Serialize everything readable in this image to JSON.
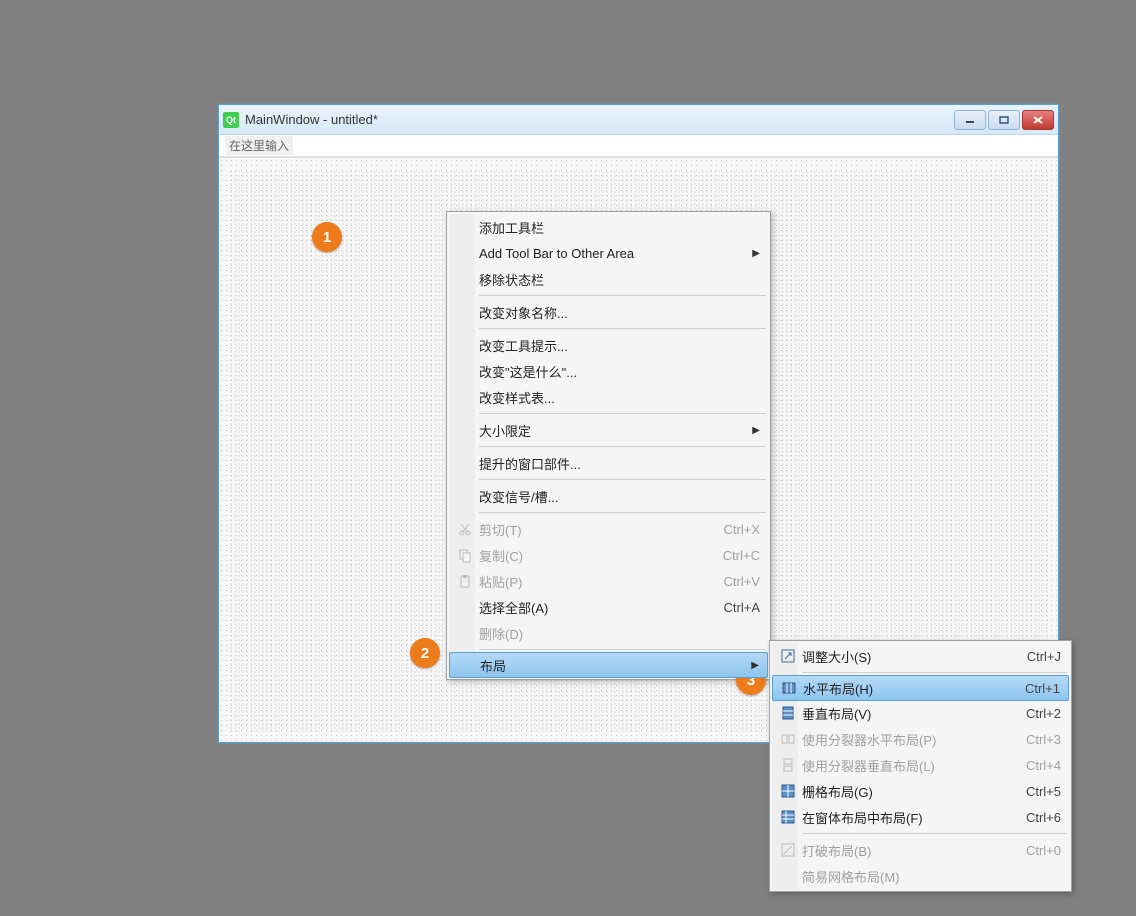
{
  "window": {
    "title": "MainWindow - untitled*",
    "menubar_placeholder": "在这里输入"
  },
  "annotations": {
    "a1": "1",
    "a2": "2",
    "a3": "3"
  },
  "ctx": {
    "add_toolbar": "添加工具栏",
    "add_toolbar_area": "Add Tool Bar to Other Area",
    "remove_statusbar": "移除状态栏",
    "change_name": "改变对象名称...",
    "change_tooltip": "改变工具提示...",
    "change_whatsthis": "改变\"这是什么\"...",
    "change_stylesheet": "改变样式表...",
    "size_limit": "大小限定",
    "promote_widget": "提升的窗口部件...",
    "change_signal_slot": "改变信号/槽...",
    "cut": "剪切(T)",
    "cut_sc": "Ctrl+X",
    "copy": "复制(C)",
    "copy_sc": "Ctrl+C",
    "paste": "粘贴(P)",
    "paste_sc": "Ctrl+V",
    "select_all": "选择全部(A)",
    "select_all_sc": "Ctrl+A",
    "delete": "删除(D)",
    "layout": "布局"
  },
  "layout_submenu": {
    "adjust_size": "调整大小(S)",
    "adjust_size_sc": "Ctrl+J",
    "hlayout": "水平布局(H)",
    "hlayout_sc": "Ctrl+1",
    "vlayout": "垂直布局(V)",
    "vlayout_sc": "Ctrl+2",
    "hsplitter": "使用分裂器水平布局(P)",
    "hsplitter_sc": "Ctrl+3",
    "vsplitter": "使用分裂器垂直布局(L)",
    "vsplitter_sc": "Ctrl+4",
    "grid": "栅格布局(G)",
    "grid_sc": "Ctrl+5",
    "formlayout": "在窗体布局中布局(F)",
    "formlayout_sc": "Ctrl+6",
    "break_layout": "打破布局(B)",
    "break_layout_sc": "Ctrl+0",
    "simple_grid": "简易网格布局(M)"
  }
}
